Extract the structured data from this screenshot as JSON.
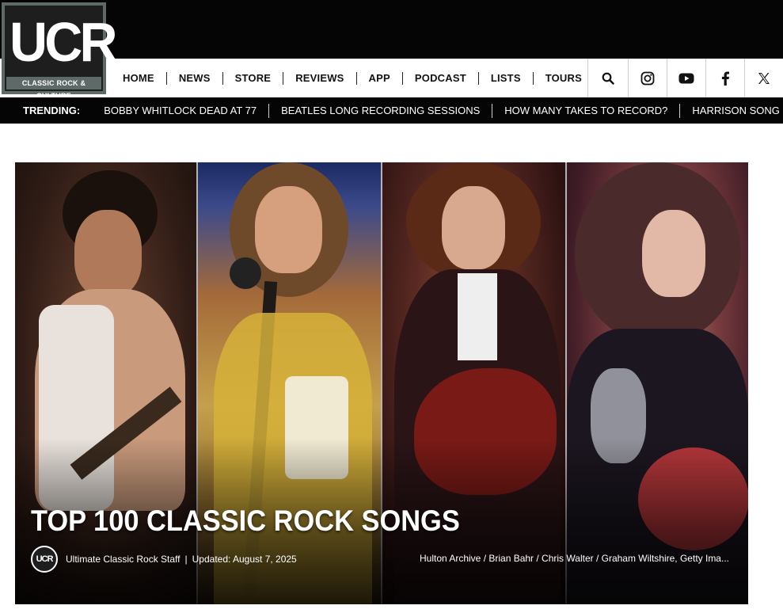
{
  "logo": {
    "letters": "UCR",
    "tagline": "CLASSIC ROCK & CULTURE"
  },
  "nav": {
    "items": [
      "HOME",
      "NEWS",
      "STORE",
      "REVIEWS",
      "APP",
      "PODCAST",
      "LISTS",
      "TOURS"
    ],
    "icons": [
      "search-icon",
      "instagram-icon",
      "youtube-icon",
      "facebook-icon",
      "x-icon"
    ]
  },
  "trending": {
    "label": "TRENDING:",
    "items": [
      "BOBBY WHITLOCK DEAD AT 77",
      "BEATLES LONG RECORDING SESSIONS",
      "HOW MANY TAKES TO RECORD?",
      "HARRISON SONG OPENS 'WEAPONS'"
    ]
  },
  "hero": {
    "title": "TOP 100 CLASSIC ROCK SONGS",
    "author": "Ultimate Classic Rock Staff",
    "separator": "|",
    "updated": "Updated: August 7, 2025",
    "avatar_text": "UCR",
    "credits": "Hulton Archive / Brian Bahr / Chris Walter / Graham Wiltshire, Getty Ima..."
  },
  "colors": {
    "brand_gray": "#5d6a68",
    "header_bg": "#050505",
    "nav_bg": "#ffffff"
  }
}
